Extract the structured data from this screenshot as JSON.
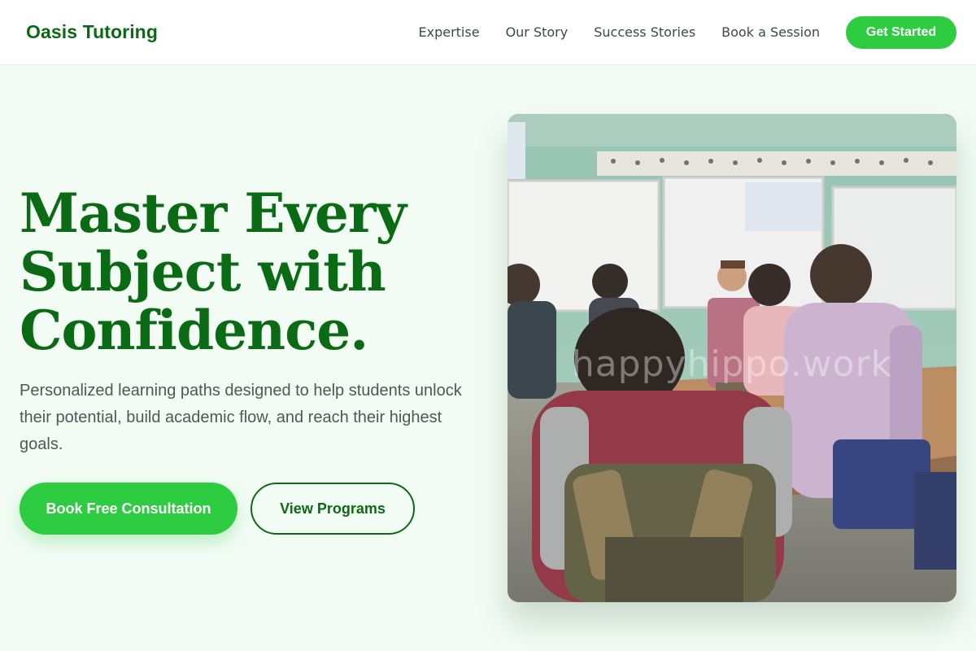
{
  "brand": {
    "name": "Oasis Tutoring"
  },
  "nav": {
    "items": [
      {
        "label": "Expertise"
      },
      {
        "label": "Our Story"
      },
      {
        "label": "Success Stories"
      },
      {
        "label": "Book a Session"
      }
    ],
    "cta_label": "Get Started"
  },
  "hero": {
    "title_lines": [
      "Master Every",
      "Subject with",
      "Confidence."
    ],
    "subtitle": "Personalized learning paths designed to help students unlock their potential, build academic flow, and reach their highest goals.",
    "primary_button": "Book Free Consultation",
    "secondary_button": "View Programs"
  },
  "image": {
    "subject": "classroom-photo",
    "watermark": "happyhippo.work"
  },
  "colors": {
    "brand_green": "#0b6b14",
    "accent_green": "#2ecc40",
    "page_bg": "#f2fcf5",
    "header_bg": "#ffffff",
    "body_text": "#4b5a55"
  }
}
